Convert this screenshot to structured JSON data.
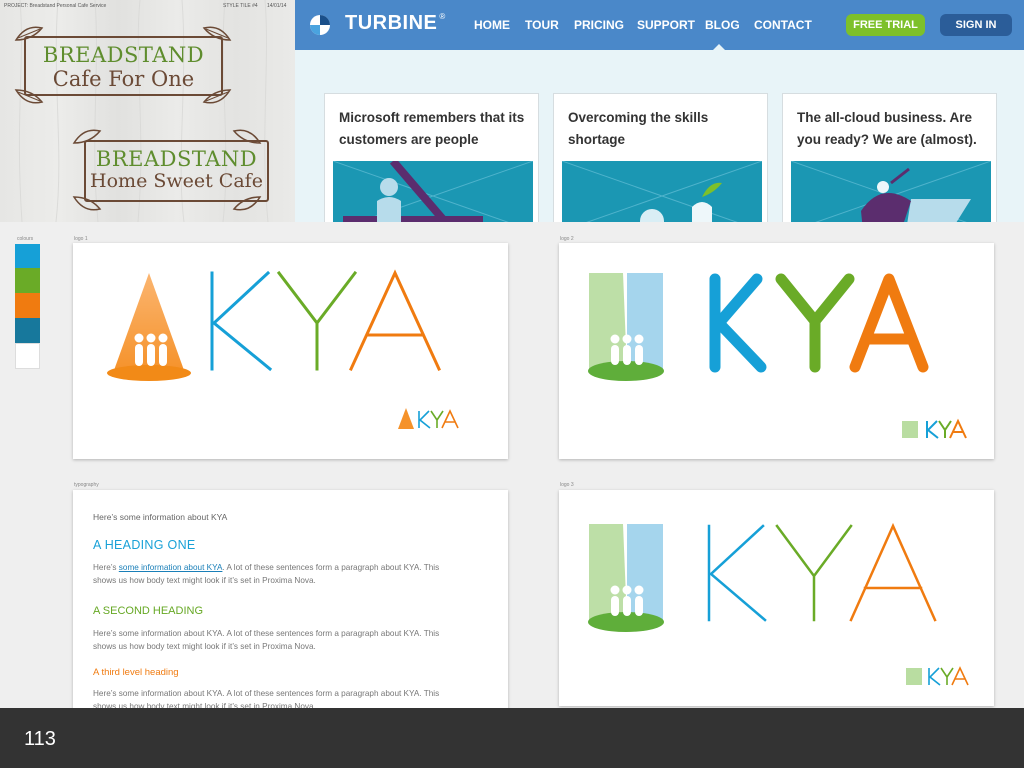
{
  "style_tile": {
    "project": "PROJECT: Breadstand Personal Cafe Service",
    "tile_no": "STYLE TILE #4",
    "date": "14/01/14",
    "logo1": {
      "line1": "BREADSTAND",
      "line2": "Cafe For One"
    },
    "logo2": {
      "line1": "BREADSTAND",
      "line2": "Home Sweet Cafe"
    },
    "colors": {
      "green": "#5f8d2e",
      "brown": "#6b4a36"
    }
  },
  "turbine": {
    "brand": "TURBINE",
    "brand_mark": "®",
    "nav": [
      "HOME",
      "TOUR",
      "PRICING",
      "SUPPORT",
      "BLOG",
      "CONTACT"
    ],
    "active_nav": "BLOG",
    "trial_button": "FREE TRIAL",
    "signin_button": "SIGN IN",
    "cards": [
      {
        "title": "Microsoft remembers that its customers are people"
      },
      {
        "title": "Overcoming the skills shortage"
      },
      {
        "title": "The all-cloud business. Are you ready? We are (almost)."
      }
    ],
    "colors": {
      "nav": "#4a88c9",
      "trial": "#7dc02a",
      "signin": "#2b5d99"
    }
  },
  "boards": {
    "colours_label": "colours",
    "logo1_label": "logo 1",
    "logo2_label": "logo 2",
    "logo3_label": "logo 3",
    "typography_label": "typography",
    "wordmark": "KYA",
    "swatches": [
      "#16a0d7",
      "#6aab27",
      "#f07b10",
      "#17789c",
      "#ffffff"
    ]
  },
  "typography": {
    "intro": "Here’s some information about KYA",
    "h1": "A HEADING ONE",
    "p1_pre": "Here’s ",
    "p1_link": "some information about KYA",
    "p1_post": ". A lot of these sentences form a paragraph about KYA. This shows us how body text might look if it’s set in Proxima Nova.",
    "h2": "A SECOND HEADING",
    "p2": "Here’s some information about KYA. A lot of these sentences form a paragraph about KYA. This shows us how body text might look if it’s set in Proxima Nova.",
    "h3": "A third level heading",
    "p3": "Here’s some information about KYA. A lot of these sentences form a paragraph about KYA. This shows us how body text might look if it’s set in Proxima Nova."
  },
  "slide": {
    "number": "113"
  }
}
